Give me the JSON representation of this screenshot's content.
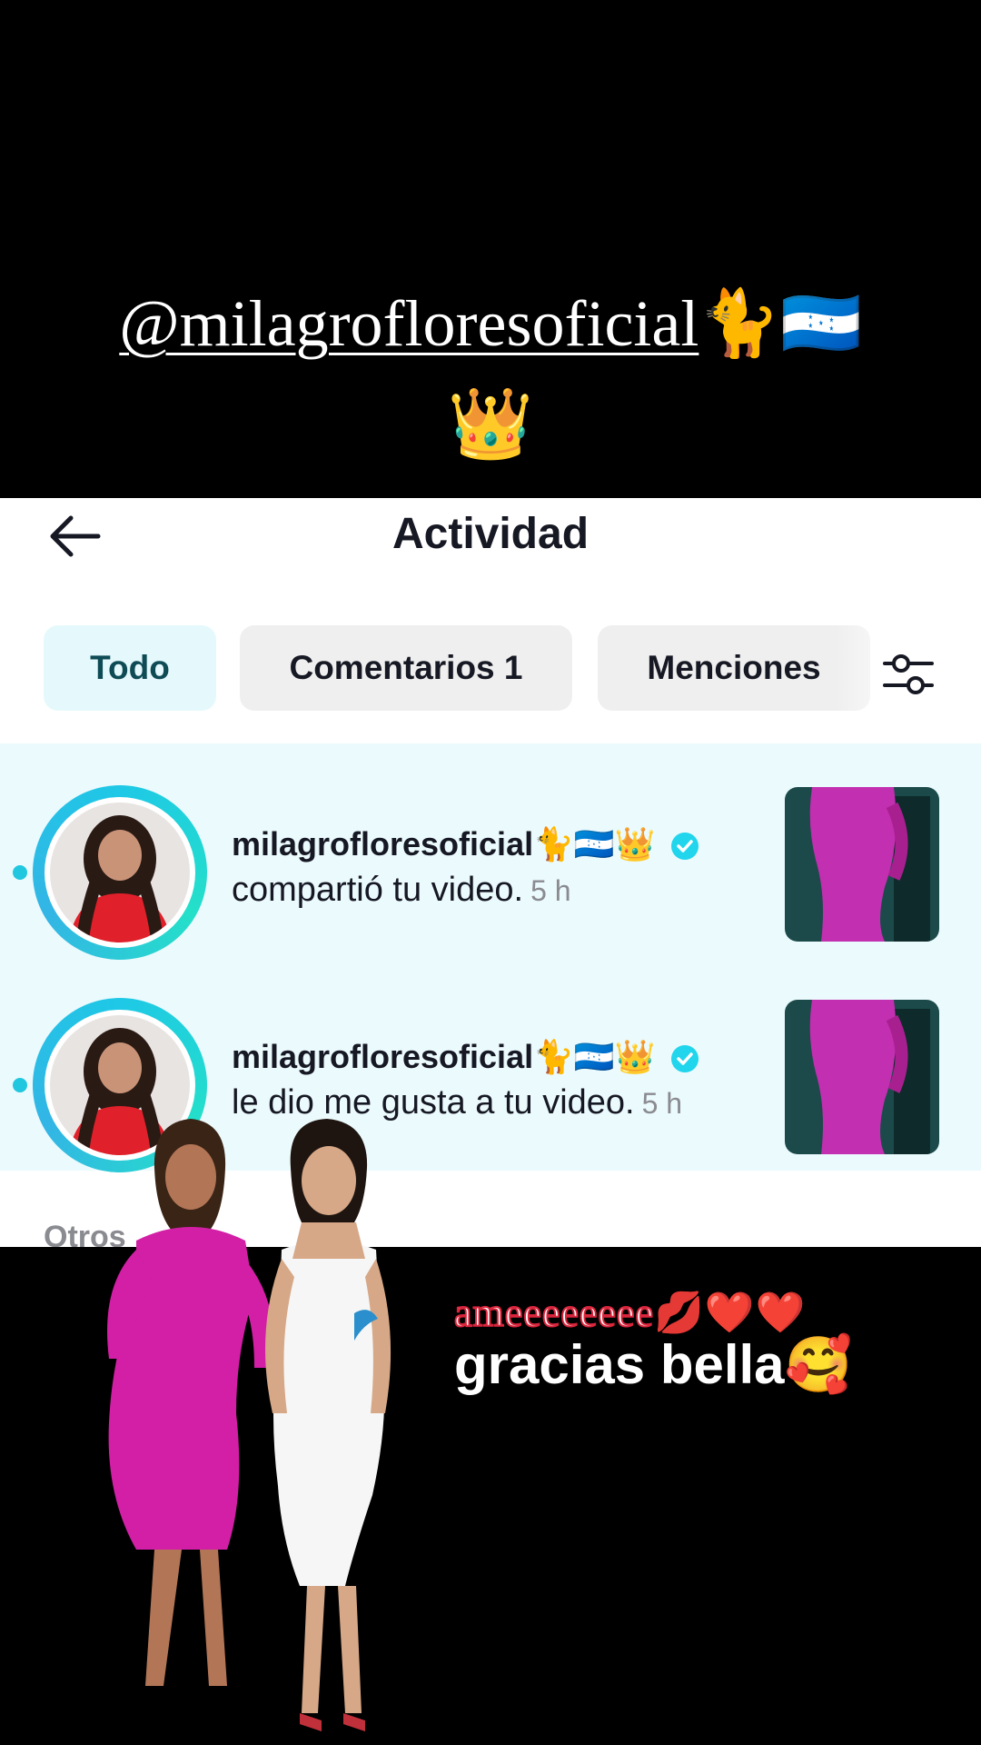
{
  "overlay": {
    "top_handle": "@milagrofloresoficial",
    "top_emojis": "🐈🇭🇳",
    "top_crown": "👑",
    "bottom_line1": "ameeeeeeee",
    "bottom_line1_emojis": "💋❤️❤️",
    "bottom_line2": "gracias bella",
    "bottom_line2_emoji": "🥰"
  },
  "header": {
    "title": "Actividad",
    "back_icon": "arrow-left-icon"
  },
  "filters": {
    "chips": [
      {
        "label": "Todo",
        "active": true
      },
      {
        "label": "Comentarios 1",
        "active": false
      },
      {
        "label": "Menciones",
        "active": false
      }
    ],
    "filter_icon": "sliders-icon"
  },
  "notifications": [
    {
      "username": "milagrofloresoficial",
      "username_emojis": "🐈🇭🇳👑",
      "verified": true,
      "action": "compartió tu video.",
      "time": "5 h"
    },
    {
      "username": "milagrofloresoficial",
      "username_emojis": "🐈🇭🇳👑",
      "verified": true,
      "action": "le dio me gusta a tu video.",
      "time": "5 h"
    }
  ],
  "section": {
    "others_label": "Otros"
  },
  "colors": {
    "active_chip_bg": "#e5f9fc",
    "list_bg": "#ebfafd",
    "accent": "#20c7df"
  }
}
